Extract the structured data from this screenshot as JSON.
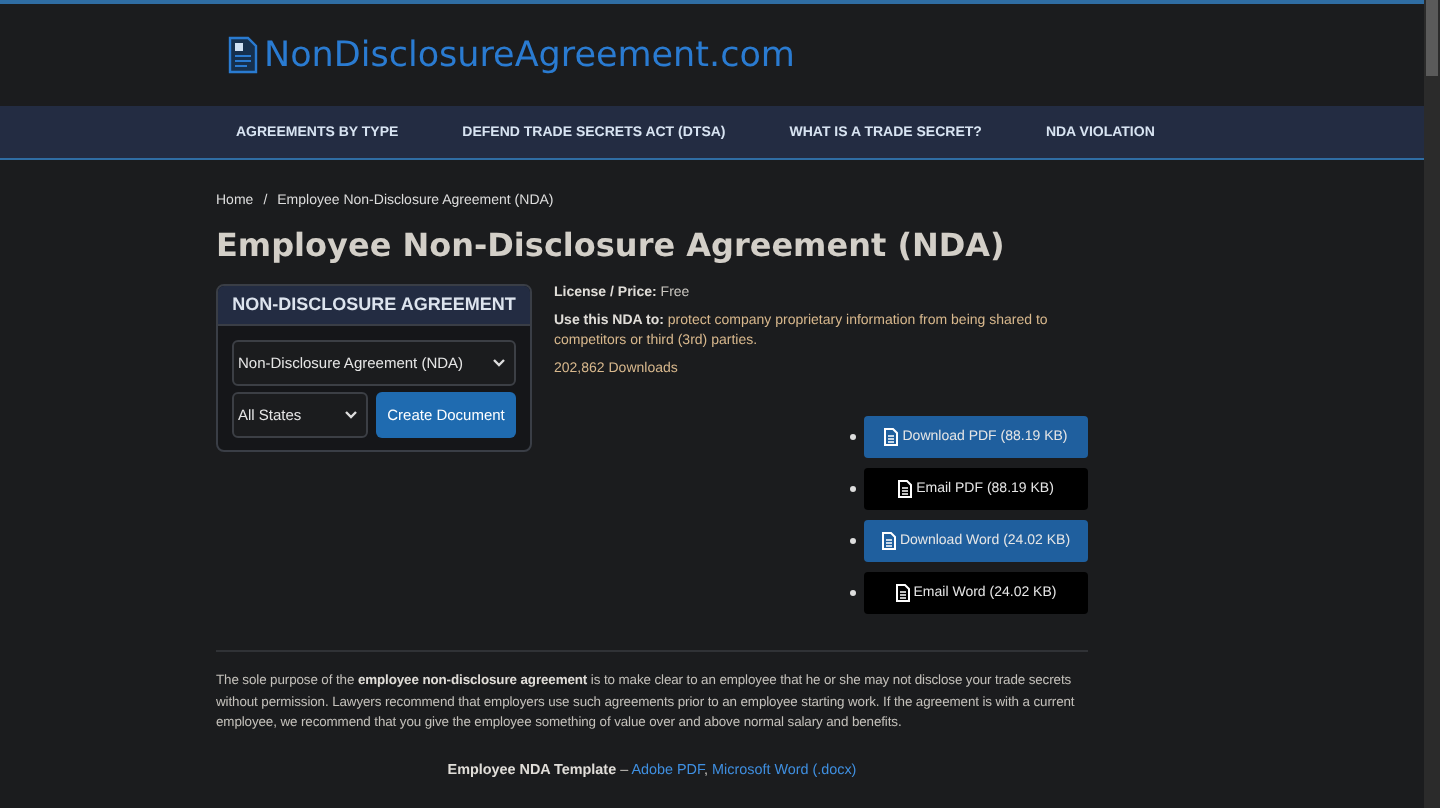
{
  "site": {
    "logo": "NonDisclosureAgreement.com"
  },
  "nav": [
    {
      "label": "AGREEMENTS BY TYPE"
    },
    {
      "label": "DEFEND TRADE SECRETS ACT (DTSA)"
    },
    {
      "label": "WHAT IS A TRADE SECRET?"
    },
    {
      "label": "NDA VIOLATION"
    }
  ],
  "breadcrumb": {
    "items": [
      "Home",
      "Employee Non-Disclosure Agreement (NDA)"
    ],
    "separator": "/"
  },
  "title": "Employee Non-Disclosure Agreement (NDA)",
  "card": {
    "heading": "NON-DISCLOSURE AGREEMENT",
    "document_select": "Non-Disclosure Agreement (NDA)",
    "state_select": "All States",
    "button": "Create Document"
  },
  "info": {
    "license": "**License / Price:** Free",
    "use": "**Use this NDA to:** protect company proprietary information from being shared to competitors or third (3rd) parties.",
    "downloads": "202,862 Downloads"
  },
  "downloads": [
    {
      "label": "Download PDF (88.19 KB)",
      "kind": "primary"
    },
    {
      "label": "Email PDF (88.19 KB)",
      "kind": "dark"
    },
    {
      "label": "Download Word (24.02 KB)",
      "kind": "primary"
    },
    {
      "label": "Email Word (24.02 KB)",
      "kind": "dark"
    }
  ],
  "description": "The sole purpose of the **employee non-disclosure agreement** is to make clear to an employee that he or she may not disclose your trade secrets without permission. Lawyers recommend that employers use such agreements prior to an employee starting work. If the agreement is with a current employee, we recommend that you give the employee something of value over and above normal salary and benefits.",
  "template": {
    "label": "Employee NDA Template",
    "separator": "–",
    "link_separator": ",",
    "links": [
      "Adobe PDF",
      "Microsoft Word (.docx)"
    ]
  }
}
